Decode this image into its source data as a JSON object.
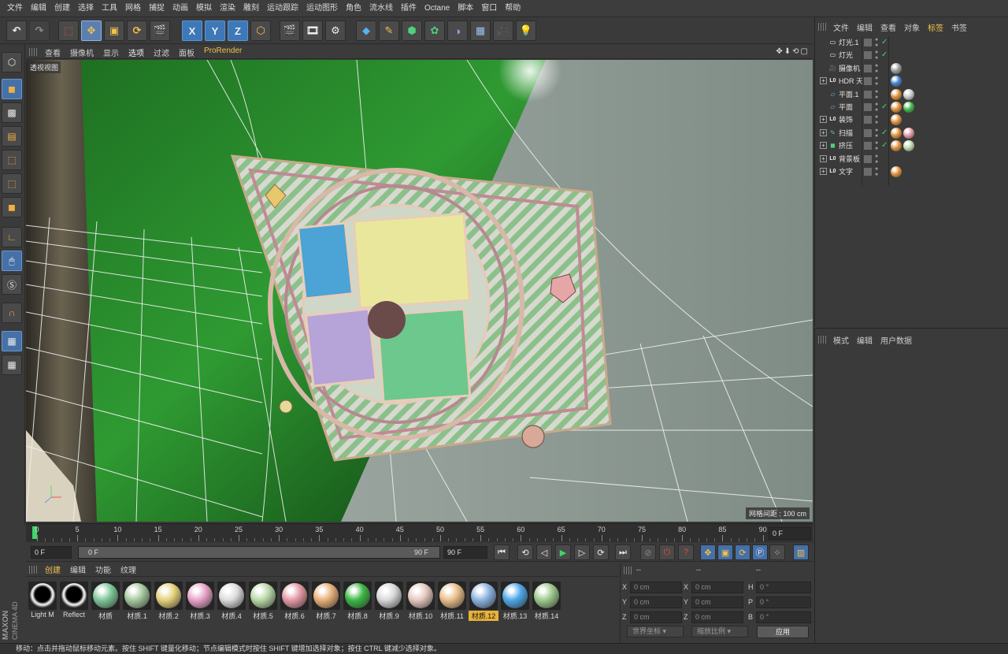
{
  "menubar": [
    "文件",
    "编辑",
    "创建",
    "选择",
    "工具",
    "网格",
    "捕捉",
    "动画",
    "模拟",
    "渲染",
    "雕刻",
    "运动跟踪",
    "运动图形",
    "角色",
    "流水线",
    "插件",
    "Octane",
    "脚本",
    "窗口",
    "帮助"
  ],
  "toolbar": {
    "undo_icon": "undo-icon",
    "redo_icon": "redo-icon",
    "x_label": "X",
    "y_label": "Y",
    "z_label": "Z"
  },
  "viewport": {
    "menu": [
      "查看",
      "摄像机",
      "显示",
      "选项",
      "过滤",
      "面板",
      "ProRender"
    ],
    "label": "透视视图",
    "grid_spacing": "网格间距 : 100 cm",
    "nav_glyphs": "✥⬇⟲▢"
  },
  "timeline": {
    "ticks": [
      "0",
      "5",
      "10",
      "15",
      "20",
      "25",
      "30",
      "35",
      "40",
      "45",
      "50",
      "55",
      "60",
      "65",
      "70",
      "75",
      "80",
      "85",
      "90"
    ],
    "current_frame": "0 F"
  },
  "transport": {
    "start": "0 F",
    "range_start": "0 F",
    "range_end": "90 F",
    "end": "90 F"
  },
  "materials": {
    "menu": [
      "创建",
      "编辑",
      "功能",
      "纹理"
    ],
    "items": [
      {
        "name": "Light M",
        "color": "#ffffff",
        "type": "dark"
      },
      {
        "name": "Reflect",
        "color": "#ffffff",
        "type": "dark"
      },
      {
        "name": "材质",
        "color": "#7fc79a",
        "type": "ball"
      },
      {
        "name": "材质.1",
        "color": "#a6c9a0",
        "type": "ball"
      },
      {
        "name": "材质.2",
        "color": "#e4d27c",
        "type": "ball"
      },
      {
        "name": "材质.3",
        "color": "#e9a3c8",
        "type": "ball"
      },
      {
        "name": "材质.4",
        "color": "#dcdcdc",
        "type": "ball"
      },
      {
        "name": "材质.5",
        "color": "#b8d9a8",
        "type": "ball"
      },
      {
        "name": "材质.6",
        "color": "#e39aa6",
        "type": "ball"
      },
      {
        "name": "材质.7",
        "color": "#e8b07a",
        "type": "ball"
      },
      {
        "name": "材质.8",
        "color": "#3fb847",
        "type": "ball"
      },
      {
        "name": "材质.9",
        "color": "#d8d8d8",
        "type": "ball"
      },
      {
        "name": "材质.10",
        "color": "#e7c9c0",
        "type": "ball"
      },
      {
        "name": "材质.11",
        "color": "#e9be8a",
        "type": "ball"
      },
      {
        "name": "材质.12",
        "color": "#8cb3e0",
        "type": "ball",
        "selected": true
      },
      {
        "name": "材质.13",
        "color": "#4fa8e8",
        "type": "ball"
      },
      {
        "name": "材质.14",
        "color": "#9ec98c",
        "type": "ball"
      }
    ]
  },
  "coords": {
    "headers": [
      "--",
      "--",
      "--"
    ],
    "rows": [
      {
        "a": "X",
        "av": "0 cm",
        "b": "X",
        "bv": "0 cm",
        "c": "H",
        "cv": "0 °"
      },
      {
        "a": "Y",
        "av": "0 cm",
        "b": "Y",
        "bv": "0 cm",
        "c": "P",
        "cv": "0 °"
      },
      {
        "a": "Z",
        "av": "0 cm",
        "b": "Z",
        "bv": "0 cm",
        "c": "B",
        "cv": "0 °"
      }
    ],
    "world_coords": "世界坐标",
    "scale": "缩放比例",
    "apply": "应用"
  },
  "objects": {
    "menu": [
      "文件",
      "编辑",
      "查看",
      "对象",
      "标签",
      "书签"
    ],
    "items": [
      {
        "name": "灯光.1",
        "icon": "light-icon",
        "expand": false,
        "check": true,
        "tags": []
      },
      {
        "name": "灯光",
        "icon": "light-icon",
        "expand": false,
        "check": true,
        "tags": []
      },
      {
        "name": "摄像机",
        "icon": "camera-icon",
        "expand": false,
        "check": false,
        "tags": [
          "#9a9a9a"
        ]
      },
      {
        "name": "HDR 天空",
        "icon": "null-icon",
        "expand": true,
        "check": false,
        "tags": [
          "#4a7fd0"
        ]
      },
      {
        "name": "平面.1",
        "icon": "plane-icon",
        "expand": false,
        "check": false,
        "tags": [
          "#e0903a",
          "#c8c8c8"
        ]
      },
      {
        "name": "平面",
        "icon": "plane-icon",
        "expand": false,
        "check": true,
        "tags": [
          "#e0903a",
          "#3fb847"
        ]
      },
      {
        "name": "装饰",
        "icon": "null-icon",
        "expand": true,
        "check": false,
        "tags": [
          "#e0903a"
        ]
      },
      {
        "name": "扫描",
        "icon": "sweep-icon",
        "expand": true,
        "check": true,
        "tags": [
          "#e0903a",
          "#e39aa6"
        ]
      },
      {
        "name": "挤压",
        "icon": "extrude-icon",
        "expand": true,
        "check": true,
        "tags": [
          "#e0903a",
          "#b8d9a8"
        ]
      },
      {
        "name": "背景板",
        "icon": "null-icon",
        "expand": true,
        "check": false,
        "tags": []
      },
      {
        "name": "文字",
        "icon": "null-icon",
        "expand": true,
        "check": false,
        "tags": [
          "#e0903a"
        ]
      }
    ]
  },
  "attributes": {
    "menu": [
      "模式",
      "编辑",
      "用户数据"
    ]
  },
  "status": "移动：点击并拖动鼠标移动元素。按住 SHIFT 键量化移动；节点编辑模式时按住 SHIFT 键增加选择对象；按住 CTRL 键减少选择对象。",
  "brand": {
    "line1": "MAXON",
    "line2": "CINEMA 4D"
  }
}
